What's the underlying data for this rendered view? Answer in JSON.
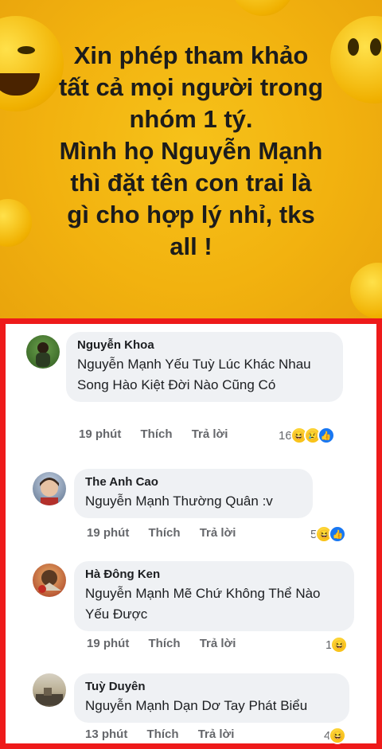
{
  "post": {
    "lines": [
      "Xin phép tham khảo",
      "tất cả mọi người trong",
      "nhóm 1 tý.",
      "Mình họ Nguyễn Mạnh",
      "thì đặt tên con trai là",
      "gì cho hợp lý nhỉ, tks",
      "all !"
    ],
    "background_color": "#f2b20f"
  },
  "frame_color": "#ee1a1a",
  "actions": {
    "like": "Thích",
    "reply": "Trả lời"
  },
  "comments": [
    {
      "author": "Nguyễn Khoa",
      "text": "Nguyễn Mạnh Yếu Tuỳ Lúc Khác Nhau Song Hào Kiệt Đời Nào Cũng Có",
      "time": "19 phút",
      "reaction_count": "16",
      "reactions": [
        "haha-icon",
        "sad-icon",
        "like-icon"
      ]
    },
    {
      "author": "The Anh Cao",
      "text": "Nguyễn Mạnh Thường Quân :v",
      "time": "19 phút",
      "reaction_count": "5",
      "reactions": [
        "haha-icon",
        "like-icon"
      ]
    },
    {
      "author": "Hà Đông Ken",
      "text": "Nguyễn Mạnh Mẽ Chứ Không Thể Nào Yếu Được",
      "time": "19 phút",
      "reaction_count": "1",
      "reactions": [
        "haha-icon"
      ]
    },
    {
      "author": "Tuỳ Duyên",
      "text": "Nguyễn Mạnh Dạn Dơ Tay Phát Biểu",
      "time": "13 phút",
      "reaction_count": "4",
      "reactions": [
        "haha-icon"
      ]
    }
  ]
}
